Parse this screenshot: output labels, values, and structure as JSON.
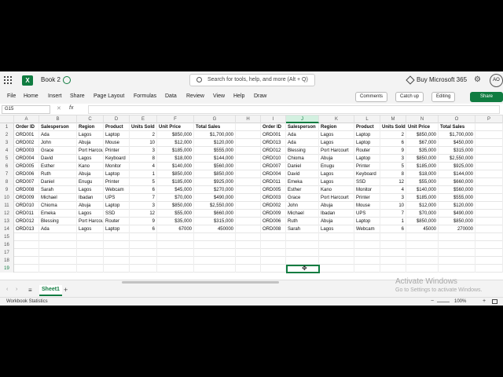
{
  "app": {
    "doc_title": "Book 2",
    "search_placeholder": "Search for tools, help, and more (Alt + Q)",
    "buy_label": "Buy Microsoft 365",
    "avatar_initials": "AO",
    "brand_color": "#107c41"
  },
  "ribbon": {
    "tabs": [
      "File",
      "Home",
      "Insert",
      "Share",
      "Page Layout",
      "Formulas",
      "Data",
      "Review",
      "View",
      "Help",
      "Draw"
    ],
    "comments_label": "Comments",
    "catchup_label": "Catch up",
    "editing_label": "Editing",
    "share_label": "Share"
  },
  "formula_bar": {
    "name_box": "G15",
    "fx_label": "fx"
  },
  "columns": [
    "A",
    "B",
    "C",
    "D",
    "E",
    "F",
    "G",
    "H",
    "I",
    "J",
    "K",
    "L",
    "M",
    "N",
    "O",
    "P"
  ],
  "selected_column": "J",
  "row_numbers": [
    "1",
    "2",
    "3",
    "4",
    "5",
    "6",
    "7",
    "8",
    "9",
    "10",
    "11",
    "12",
    "13",
    "14",
    "15",
    "16",
    "17",
    "18",
    "19"
  ],
  "selected_row": "19",
  "table_left": {
    "headers": [
      "Order ID",
      "Salesperson",
      "Region",
      "Product",
      "Units Sold",
      "Unit Price",
      "Total Sales"
    ],
    "rows": [
      [
        "ORD001",
        "Ada",
        "Lagos",
        "Laptop",
        "2",
        "$850,000",
        "$1,700,000"
      ],
      [
        "ORD002",
        "John",
        "Abuja",
        "Mouse",
        "10",
        "$12,000",
        "$120,000"
      ],
      [
        "ORD003",
        "Grace",
        "Port Harcourt",
        "Printer",
        "3",
        "$185,000",
        "$555,000"
      ],
      [
        "ORD004",
        "David",
        "Lagos",
        "Keyboard",
        "8",
        "$18,000",
        "$144,000"
      ],
      [
        "ORD005",
        "Esther",
        "Kano",
        "Monitor",
        "4",
        "$140,000",
        "$560,000"
      ],
      [
        "ORD006",
        "Ruth",
        "Abuja",
        "Laptop",
        "1",
        "$850,000",
        "$850,000"
      ],
      [
        "ORD007",
        "Daniel",
        "Enugu",
        "Printer",
        "5",
        "$185,000",
        "$925,000"
      ],
      [
        "ORD008",
        "Sarah",
        "Lagos",
        "Webcam",
        "6",
        "$45,000",
        "$270,000"
      ],
      [
        "ORD009",
        "Michael",
        "Ibadan",
        "UPS",
        "7",
        "$70,000",
        "$490,000"
      ],
      [
        "ORD010",
        "Chioma",
        "Abuja",
        "Laptop",
        "3",
        "$850,000",
        "$2,550,000"
      ],
      [
        "ORD011",
        "Emeka",
        "Lagos",
        "SSD",
        "12",
        "$55,000",
        "$660,000"
      ],
      [
        "ORD012",
        "Blessing",
        "Port Harcourt",
        "Router",
        "9",
        "$35,000",
        "$315,000"
      ],
      [
        "ORD013",
        "Ada",
        "Lagos",
        "Laptop",
        "6",
        "67000",
        "450000"
      ]
    ]
  },
  "table_right": {
    "headers": [
      "Order ID",
      "Salesperson",
      "Region",
      "Product",
      "Units Sold",
      "Unit Price",
      "Total Sales"
    ],
    "rows": [
      [
        "ORD001",
        "Ada",
        "Lagos",
        "Laptop",
        "2",
        "$850,000",
        "$1,700,000"
      ],
      [
        "ORD013",
        "Ada",
        "Lagos",
        "Laptop",
        "6",
        "$67,000",
        "$450,000"
      ],
      [
        "ORD012",
        "Blessing",
        "Port Harcourt",
        "Router",
        "9",
        "$35,000",
        "$315,000"
      ],
      [
        "ORD010",
        "Chioma",
        "Abuja",
        "Laptop",
        "3",
        "$850,000",
        "$2,550,000"
      ],
      [
        "ORD007",
        "Daniel",
        "Enugu",
        "Printer",
        "5",
        "$185,000",
        "$925,000"
      ],
      [
        "ORD004",
        "David",
        "Lagos",
        "Keyboard",
        "8",
        "$18,000",
        "$144,000"
      ],
      [
        "ORD011",
        "Emeka",
        "Lagos",
        "SSD",
        "12",
        "$55,000",
        "$660,000"
      ],
      [
        "ORD005",
        "Esther",
        "Kano",
        "Monitor",
        "4",
        "$140,000",
        "$560,000"
      ],
      [
        "ORD003",
        "Grace",
        "Port Harcourt",
        "Printer",
        "3",
        "$185,000",
        "$555,000"
      ],
      [
        "ORD002",
        "John",
        "Abuja",
        "Mouse",
        "10",
        "$12,000",
        "$120,000"
      ],
      [
        "ORD009",
        "Michael",
        "Ibadan",
        "UPS",
        "7",
        "$70,000",
        "$490,000"
      ],
      [
        "ORD006",
        "Ruth",
        "Abuja",
        "Laptop",
        "1",
        "$850,000",
        "$850,000"
      ],
      [
        "ORD008",
        "Sarah",
        "Lagos",
        "Webcam",
        "6",
        "45000",
        "270000"
      ]
    ]
  },
  "sheets": {
    "tabs": [
      "Sheet1"
    ],
    "active": "Sheet1"
  },
  "watermark": {
    "line1": "Activate Windows",
    "line2": "Go to Settings to activate Windows."
  },
  "status": {
    "left": "Workbook Statistics",
    "zoom": "100%"
  }
}
